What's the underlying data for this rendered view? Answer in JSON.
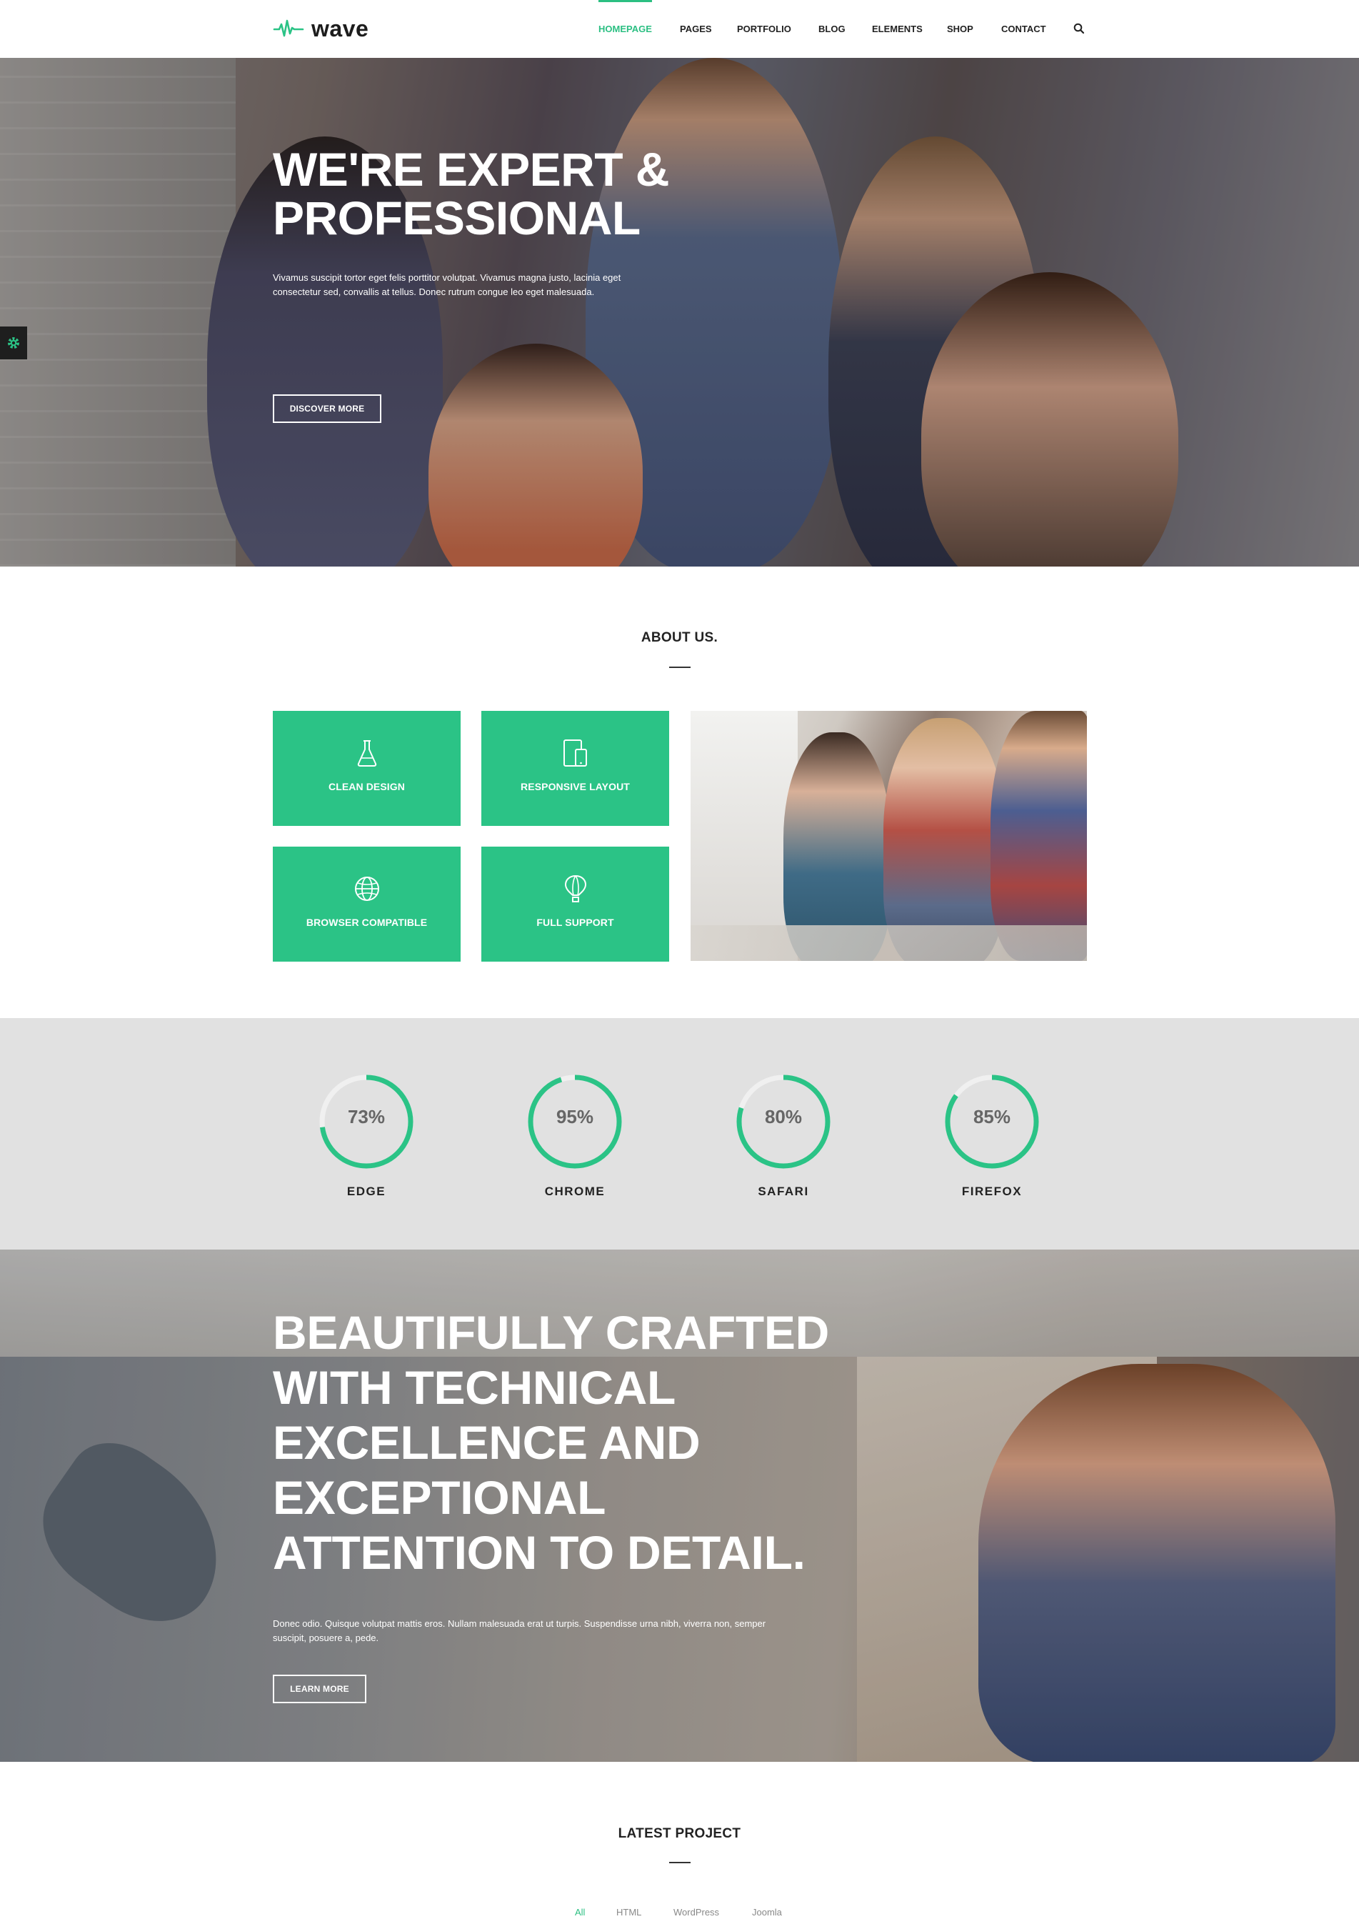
{
  "brand": {
    "name": "wave",
    "accent": "#2bc386"
  },
  "nav": {
    "items": [
      {
        "label": "HOMEPAGE",
        "active": true
      },
      {
        "label": "PAGES",
        "active": false
      },
      {
        "label": "PORTFOLIO",
        "active": false
      },
      {
        "label": "BLOG",
        "active": false
      },
      {
        "label": "ELEMENTS",
        "active": false
      },
      {
        "label": "SHOP",
        "active": false
      },
      {
        "label": "CONTACT",
        "active": false
      }
    ],
    "search_icon": "search-icon"
  },
  "hero": {
    "title_line1": "WE'RE EXPERT &",
    "title_line2": "PROFESSIONAL",
    "text_line1": "Vivamus suscipit tortor eget felis porttitor volutpat. Vivamus magna justo, lacinia eget",
    "text_line2": "consectetur sed, convallis at tellus. Donec rutrum congue leo eget malesuada.",
    "button": "DISCOVER MORE"
  },
  "about": {
    "title": "ABOUT US.",
    "features": [
      {
        "label": "CLEAN DESIGN",
        "icon": "flask-icon"
      },
      {
        "label": "RESPONSIVE LAYOUT",
        "icon": "devices-icon"
      },
      {
        "label": "BROWSER COMPATIBLE",
        "icon": "globe-icon"
      },
      {
        "label": "FULL SUPPORT",
        "icon": "balloon-icon"
      }
    ]
  },
  "stats": [
    {
      "label": "EDGE",
      "display": "73%",
      "percent": 73
    },
    {
      "label": "CHROME",
      "display": "95%",
      "percent": 95
    },
    {
      "label": "SAFARI",
      "display": "80%",
      "percent": 80
    },
    {
      "label": "FIREFOX",
      "display": "85%",
      "percent": 85
    }
  ],
  "crafted": {
    "title_lines": [
      "BEAUTIFULLY CRAFTED",
      "WITH TECHNICAL",
      "EXCELLENCE AND",
      "EXCEPTIONAL",
      "ATTENTION TO DETAIL."
    ],
    "text_line1": "Donec odio. Quisque volutpat mattis eros. Nullam malesuada erat ut turpis. Suspendisse urna nibh, viverra non, semper",
    "text_line2": "suscipit, posuere a, pede.",
    "button": "LEARN MORE"
  },
  "projects": {
    "title": "LATEST PROJECT",
    "filters": [
      {
        "label": "All",
        "active": true
      },
      {
        "label": "HTML",
        "active": false
      },
      {
        "label": "WordPress",
        "active": false
      },
      {
        "label": "Joomla",
        "active": false
      }
    ]
  }
}
